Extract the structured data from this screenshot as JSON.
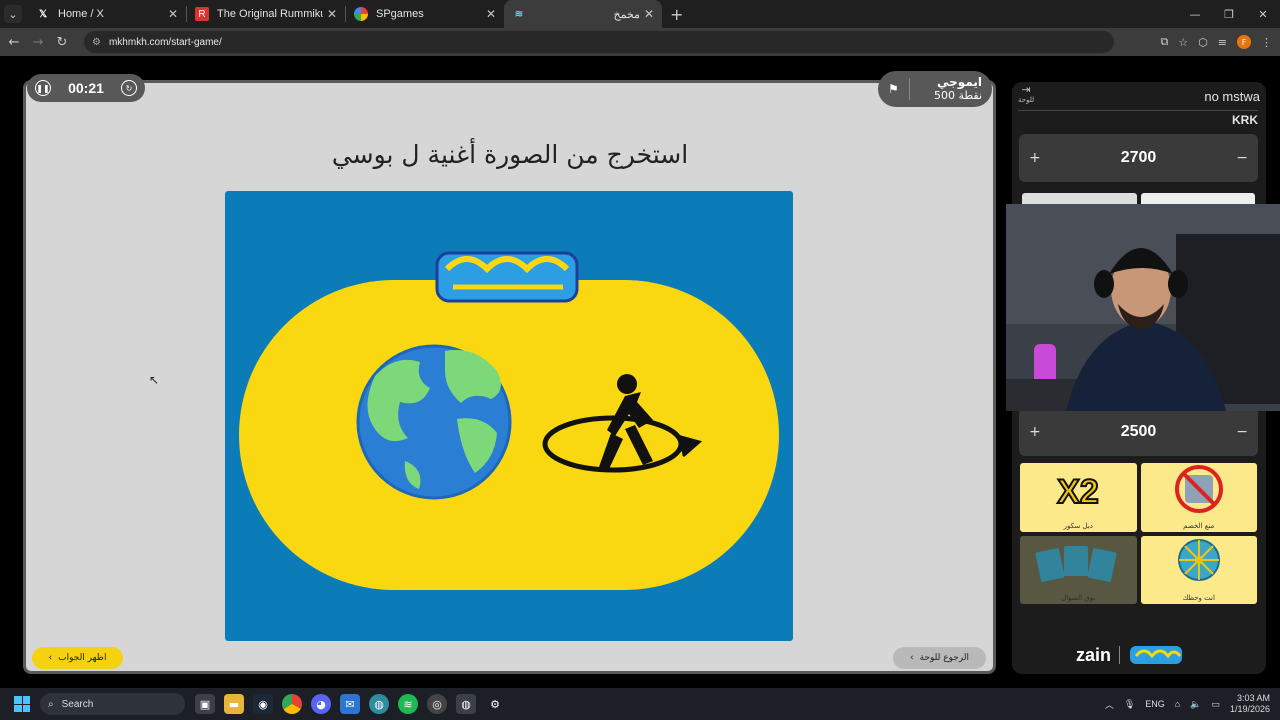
{
  "browser": {
    "tabs": [
      {
        "title": "Home / X",
        "icon": "x-logo-icon",
        "active": false
      },
      {
        "title": "The Original Rummikub",
        "icon": "rummikub-icon",
        "active": false
      },
      {
        "title": "SPgames",
        "icon": "spgames-icon",
        "active": false
      },
      {
        "title": "مخمخ",
        "icon": "mkhmkh-icon",
        "active": true
      }
    ],
    "url": "mkhmkh.com/start-game/",
    "profile_initial": "F"
  },
  "game": {
    "timer": "00:21",
    "category": "ايموجي",
    "points": "500 نقطة",
    "question": "استخرج من الصورة أغنية ل بوسي",
    "show_answer_label": "اظهر الجواب",
    "back_to_board_label": "الرجوع للوحة",
    "picture_colors": {
      "background": "#0c7cb8",
      "pill": "#f9d812",
      "earth_ocean": "#2a7fd4",
      "earth_land": "#7dd87a"
    }
  },
  "side_panel": {
    "exit_label": "للوحة",
    "team1_name": "no mstwa",
    "team2_name": "KRK",
    "team1_score": "2700",
    "team2_score": "2500",
    "plus": "+",
    "minus": "−",
    "lifelines": [
      {
        "label": "دبل سكور",
        "icon": "x2-icon"
      },
      {
        "label": "منع الخصم",
        "icon": "block-opponent-icon"
      },
      {
        "label": "بوق السؤال",
        "icon": "cards-icon"
      },
      {
        "label": "انت وحظك",
        "icon": "wheel-icon"
      }
    ],
    "sponsor": "zain"
  },
  "taskbar": {
    "search_placeholder": "Search",
    "lang": "ENG",
    "time": "3:03 AM",
    "date": "1/19/2026"
  }
}
